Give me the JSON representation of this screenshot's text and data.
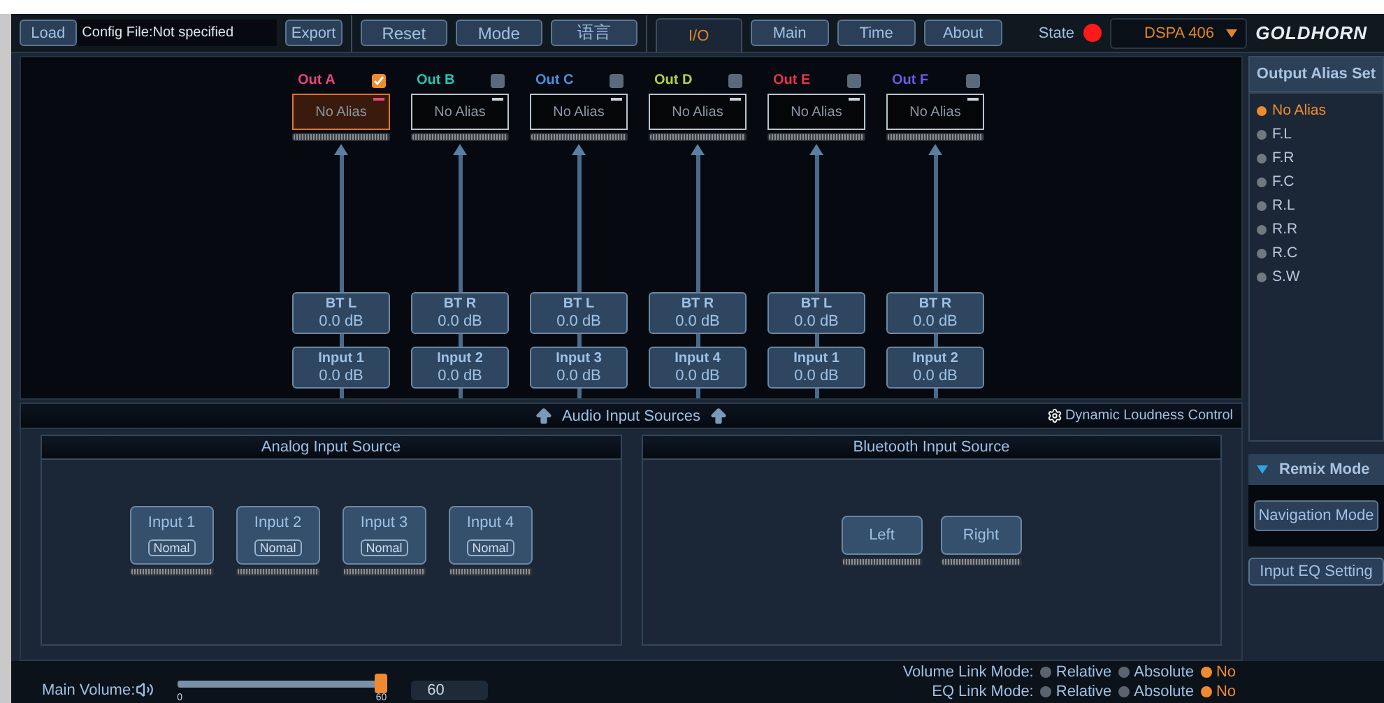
{
  "toolbar": {
    "load": "Load",
    "config": "Config File:Not specified",
    "file_buttons": [
      "Export"
    ],
    "action_buttons": [
      "Reset",
      "Mode",
      "语言"
    ]
  },
  "tabs": [
    {
      "label": "I/O",
      "selected": true
    },
    {
      "label": "Main",
      "selected": false
    },
    {
      "label": "Time",
      "selected": false
    },
    {
      "label": "About",
      "selected": false
    }
  ],
  "state": {
    "label": "State",
    "connected": false
  },
  "device": "DSPA 406",
  "logo": "GOLDHORN",
  "outputs": [
    {
      "label": "Out A",
      "color": "#e8457e",
      "checked": true,
      "selected": true,
      "alias": "No Alias",
      "mix": {
        "name": "BT L",
        "gain": "0.0 dB"
      },
      "input": {
        "name": "Input 1",
        "gain": "0.0 dB"
      }
    },
    {
      "label": "Out B",
      "color": "#27c4b4",
      "checked": false,
      "selected": false,
      "alias": "No Alias",
      "mix": {
        "name": "BT R",
        "gain": "0.0 dB"
      },
      "input": {
        "name": "Input 2",
        "gain": "0.0 dB"
      }
    },
    {
      "label": "Out C",
      "color": "#4a90e0",
      "checked": false,
      "selected": false,
      "alias": "No Alias",
      "mix": {
        "name": "BT L",
        "gain": "0.0 dB"
      },
      "input": {
        "name": "Input 3",
        "gain": "0.0 dB"
      }
    },
    {
      "label": "Out D",
      "color": "#b4d23c",
      "checked": false,
      "selected": false,
      "alias": "No Alias",
      "mix": {
        "name": "BT R",
        "gain": "0.0 dB"
      },
      "input": {
        "name": "Input 4",
        "gain": "0.0 dB"
      }
    },
    {
      "label": "Out E",
      "color": "#e8344a",
      "checked": false,
      "selected": false,
      "alias": "No Alias",
      "mix": {
        "name": "BT L",
        "gain": "0.0 dB"
      },
      "input": {
        "name": "Input 1",
        "gain": "0.0 dB"
      }
    },
    {
      "label": "Out F",
      "color": "#6a5ae8",
      "checked": false,
      "selected": false,
      "alias": "No Alias",
      "mix": {
        "name": "BT R",
        "gain": "0.0 dB"
      },
      "input": {
        "name": "Input 2",
        "gain": "0.0 dB"
      }
    }
  ],
  "sources": {
    "title": "Audio Input Sources",
    "loudness": "Dynamic Loudness Control",
    "panels": [
      {
        "title": "Analog Input Source",
        "inputs": [
          {
            "name": "Input 1",
            "mode": "Nomal"
          },
          {
            "name": "Input 2",
            "mode": "Nomal"
          },
          {
            "name": "Input 3",
            "mode": "Nomal"
          },
          {
            "name": "Input 4",
            "mode": "Nomal"
          }
        ]
      },
      {
        "title": "Bluetooth Input Source",
        "inputs": [
          {
            "name": "Left"
          },
          {
            "name": "Right"
          }
        ]
      }
    ]
  },
  "alias_panel": {
    "title": "Output Alias Set",
    "options": [
      {
        "label": "No Alias",
        "selected": true
      },
      {
        "label": "F.L",
        "selected": false
      },
      {
        "label": "F.R",
        "selected": false
      },
      {
        "label": "F.C",
        "selected": false
      },
      {
        "label": "R.L",
        "selected": false
      },
      {
        "label": "R.R",
        "selected": false
      },
      {
        "label": "R.C",
        "selected": false
      },
      {
        "label": "S.W",
        "selected": false
      }
    ]
  },
  "remix": {
    "title": "Remix Mode",
    "expanded": true,
    "button": "Navigation Mode"
  },
  "eq_button": "Input EQ Setting",
  "main_volume": {
    "label": "Main Volume:",
    "level": 0.97,
    "value": "60",
    "scale": [
      "0",
      "60"
    ]
  },
  "link_modes": [
    {
      "label": "Volume Link Mode:",
      "options": [
        {
          "label": "Relative",
          "selected": false
        },
        {
          "label": "Absolute",
          "selected": false
        },
        {
          "label": "No",
          "selected": true
        }
      ]
    },
    {
      "label": "EQ Link Mode:",
      "options": [
        {
          "label": "Relative",
          "selected": false
        },
        {
          "label": "Absolute",
          "selected": false
        },
        {
          "label": "No",
          "selected": true
        }
      ]
    }
  ]
}
